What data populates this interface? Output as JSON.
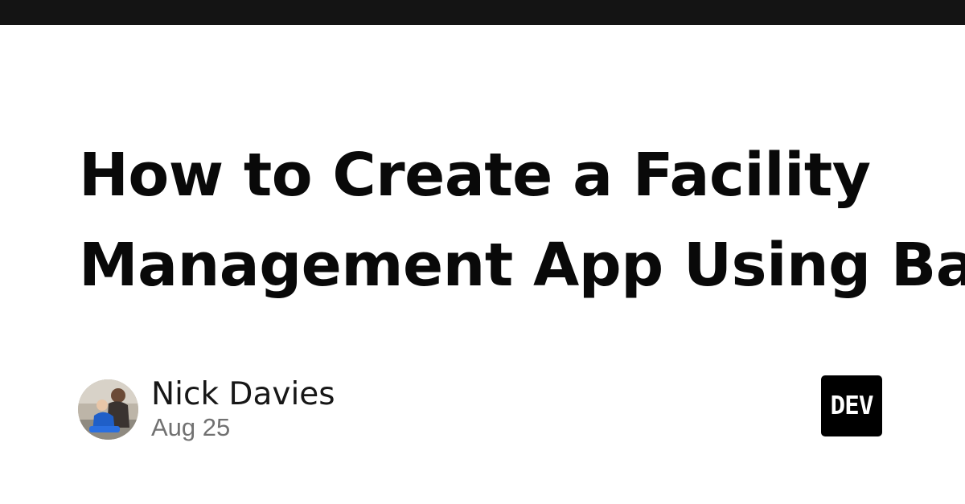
{
  "header": {
    "bar_color": "#141414"
  },
  "article": {
    "title_lines": [
      "How to Create a Facility",
      "Management App Using Baserow"
    ]
  },
  "author": {
    "name": "Nick Davies",
    "date": "Aug 25",
    "avatar_icon": "user-avatar-photo"
  },
  "brand": {
    "logo_text": "DEV",
    "logo_icon": "dev-logo-icon"
  }
}
